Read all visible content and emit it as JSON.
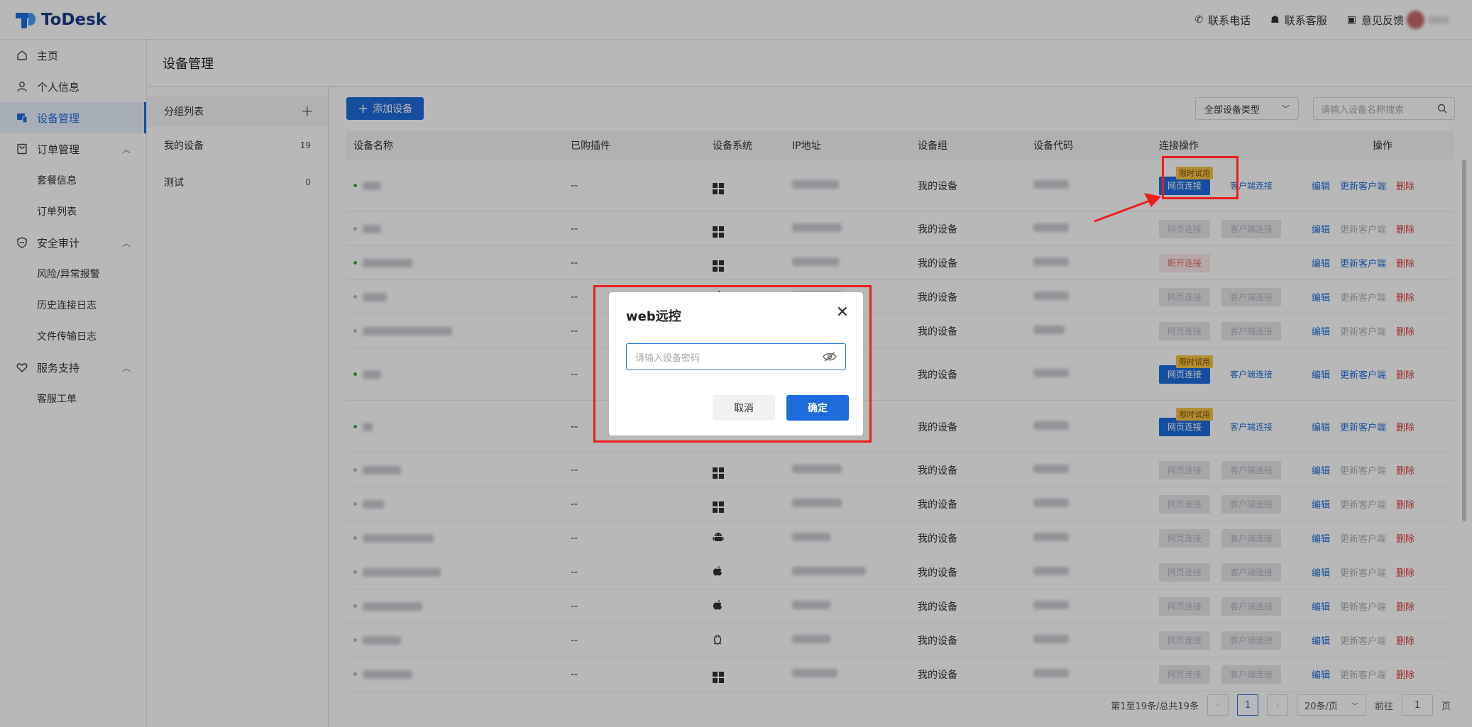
{
  "app": {
    "brand": "ToDesk"
  },
  "topbar": {
    "links": [
      {
        "icon": "phone-icon",
        "label": "联系电话"
      },
      {
        "icon": "service-icon",
        "label": "联系客服"
      },
      {
        "icon": "feedback-icon",
        "label": "意见反馈"
      }
    ]
  },
  "sidebar": {
    "items": [
      {
        "label": "主页",
        "icon": "home-icon"
      },
      {
        "label": "个人信息",
        "icon": "user-icon"
      },
      {
        "label": "设备管理",
        "icon": "device-icon",
        "active": true
      },
      {
        "label": "订单管理",
        "icon": "order-icon",
        "expanded": true,
        "children": [
          "套餐信息",
          "订单列表"
        ]
      },
      {
        "label": "安全审计",
        "icon": "shield-icon",
        "expanded": true,
        "children": [
          "风险/异常报警",
          "历史连接日志",
          "文件传输日志"
        ]
      },
      {
        "label": "服务支持",
        "icon": "heart-icon",
        "expanded": true,
        "children": [
          "客服工单"
        ]
      }
    ]
  },
  "page": {
    "title": "设备管理"
  },
  "groups": {
    "header": "分组列表",
    "items": [
      {
        "name": "我的设备",
        "count": "19"
      },
      {
        "name": "测试",
        "count": "0"
      }
    ]
  },
  "toolbar": {
    "add_label": "添加设备",
    "type_select": "全部设备类型",
    "search_placeholder": "请输入设备名称搜索"
  },
  "table": {
    "columns": [
      "设备名称",
      "已购插件",
      "设备系统",
      "IP地址",
      "设备组",
      "设备代码",
      "连接操作",
      "操作"
    ],
    "rows": [
      {
        "online": true,
        "plugin": "--",
        "os": "windows",
        "group": "我的设备",
        "conn": "trial"
      },
      {
        "online": false,
        "plugin": "--",
        "os": "windows",
        "group": "我的设备",
        "conn": "disabled"
      },
      {
        "online": true,
        "plugin": "--",
        "os": "windows",
        "group": "我的设备",
        "conn": "disconnect"
      },
      {
        "online": false,
        "plugin": "--",
        "os": "apple",
        "group": "我的设备",
        "conn": "disabled"
      },
      {
        "online": false,
        "plugin": "--",
        "os": "windows",
        "group": "我的设备",
        "conn": "disabled"
      },
      {
        "online": true,
        "plugin": "--",
        "os": "windows",
        "group": "我的设备",
        "conn": "trial"
      },
      {
        "online": true,
        "plugin": "--",
        "os": "windows",
        "group": "我的设备",
        "conn": "trial"
      },
      {
        "online": false,
        "plugin": "--",
        "os": "windows",
        "group": "我的设备",
        "conn": "disabled"
      },
      {
        "online": false,
        "plugin": "--",
        "os": "windows",
        "group": "我的设备",
        "conn": "disabled"
      },
      {
        "online": false,
        "plugin": "--",
        "os": "android",
        "group": "我的设备",
        "conn": "disabled"
      },
      {
        "online": false,
        "plugin": "--",
        "os": "apple",
        "group": "我的设备",
        "conn": "disabled"
      },
      {
        "online": false,
        "plugin": "--",
        "os": "apple",
        "group": "我的设备",
        "conn": "disabled"
      },
      {
        "online": false,
        "plugin": "--",
        "os": "linux",
        "group": "我的设备",
        "conn": "disabled"
      },
      {
        "online": false,
        "plugin": "--",
        "os": "windows",
        "group": "我的设备",
        "conn": "disabled"
      }
    ],
    "labels": {
      "web_connect": "网页连接",
      "client_connect": "客户端连接",
      "disconnect": "断开连接",
      "trial_tag": "限时试用",
      "edit": "编辑",
      "update_client": "更新客户端",
      "delete": "删除"
    }
  },
  "pagination": {
    "summary": "第1至19条/总共19条",
    "current_page": "1",
    "page_size": "20条/页",
    "goto_label": "前往",
    "goto_value": "1",
    "page_suffix": "页"
  },
  "modal": {
    "title": "web远控",
    "password_placeholder": "请输入设备密码",
    "cancel": "取消",
    "confirm": "确定"
  },
  "colors": {
    "accent": "#1e6cdb",
    "danger": "#e23b3b",
    "highlight": "#ee1c1c",
    "trial": "#f6c544"
  }
}
